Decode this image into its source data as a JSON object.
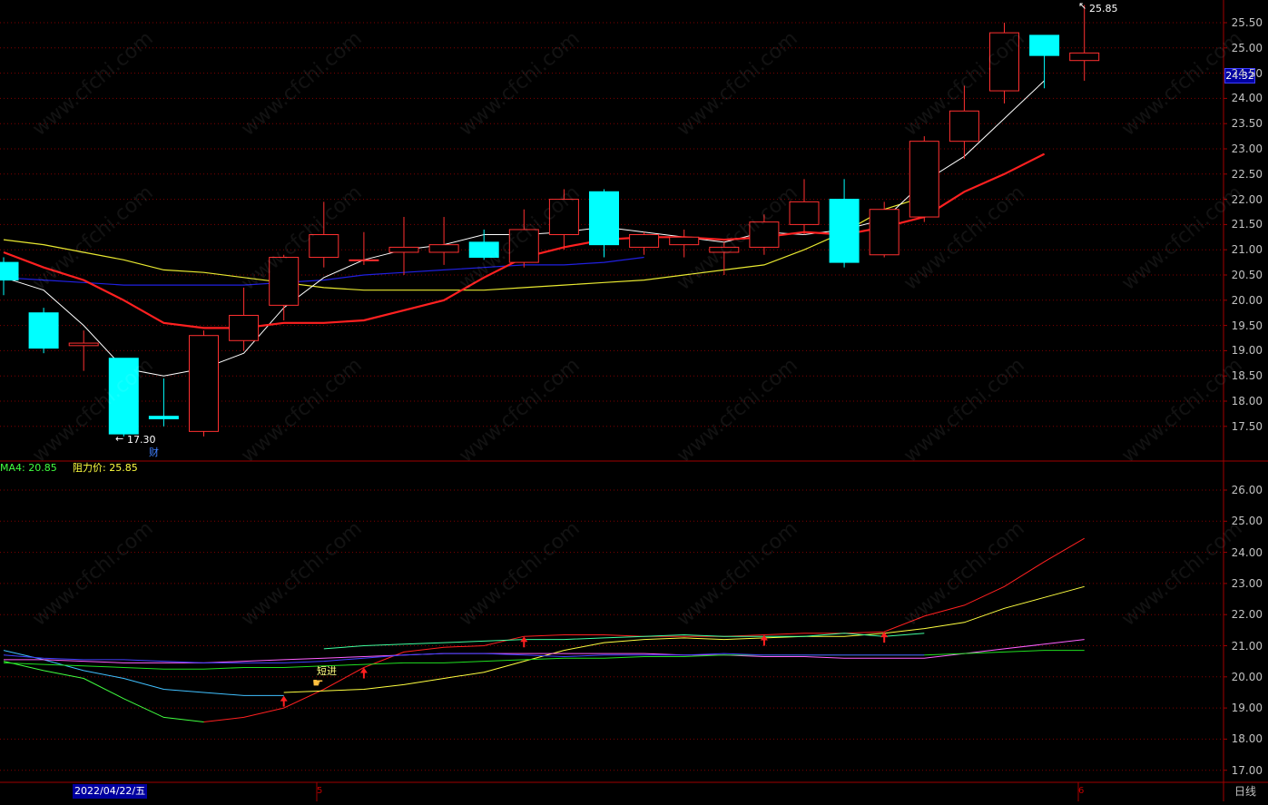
{
  "chart_data": [
    {
      "type": "candlestick",
      "panel": "main",
      "ylim": [
        17.2,
        25.85
      ],
      "yticks": [
        "25.50",
        "25.00",
        "24.50",
        "24.00",
        "23.50",
        "23.00",
        "22.50",
        "22.00",
        "21.50",
        "21.00",
        "20.50",
        "20.00",
        "19.50",
        "19.00",
        "18.50",
        "18.00",
        "17.50"
      ],
      "candles": [
        {
          "o": 20.75,
          "h": 20.85,
          "l": 20.1,
          "c": 20.4
        },
        {
          "o": 19.75,
          "h": 19.85,
          "l": 18.95,
          "c": 19.05
        },
        {
          "o": 19.1,
          "h": 19.4,
          "l": 18.6,
          "c": 19.15
        },
        {
          "o": 18.85,
          "h": 18.85,
          "l": 17.3,
          "c": 17.35
        },
        {
          "o": 17.7,
          "h": 18.45,
          "l": 17.5,
          "c": 17.65
        },
        {
          "o": 17.4,
          "h": 19.4,
          "l": 17.3,
          "c": 19.3
        },
        {
          "o": 19.2,
          "h": 20.25,
          "l": 19.0,
          "c": 19.7
        },
        {
          "o": 19.9,
          "h": 20.9,
          "l": 19.6,
          "c": 20.85
        },
        {
          "o": 20.85,
          "h": 21.95,
          "l": 20.65,
          "c": 21.3
        },
        {
          "o": 20.8,
          "h": 21.35,
          "l": 20.7,
          "c": 20.8
        },
        {
          "o": 20.95,
          "h": 21.65,
          "l": 20.5,
          "c": 21.05
        },
        {
          "o": 20.95,
          "h": 21.65,
          "l": 20.7,
          "c": 21.1
        },
        {
          "o": 21.15,
          "h": 21.4,
          "l": 20.8,
          "c": 20.85
        },
        {
          "o": 20.75,
          "h": 21.8,
          "l": 20.65,
          "c": 21.4
        },
        {
          "o": 21.3,
          "h": 22.2,
          "l": 21.0,
          "c": 22.0
        },
        {
          "o": 22.15,
          "h": 22.2,
          "l": 20.85,
          "c": 21.1
        },
        {
          "o": 21.05,
          "h": 21.35,
          "l": 20.9,
          "c": 21.3
        },
        {
          "o": 21.1,
          "h": 21.4,
          "l": 20.85,
          "c": 21.25
        },
        {
          "o": 20.95,
          "h": 21.15,
          "l": 20.5,
          "c": 21.05
        },
        {
          "o": 21.05,
          "h": 21.7,
          "l": 20.9,
          "c": 21.55
        },
        {
          "o": 21.5,
          "h": 22.4,
          "l": 21.3,
          "c": 21.95
        },
        {
          "o": 22.0,
          "h": 22.4,
          "l": 20.65,
          "c": 20.75
        },
        {
          "o": 20.9,
          "h": 21.95,
          "l": 20.85,
          "c": 21.8
        },
        {
          "o": 21.65,
          "h": 23.25,
          "l": 21.55,
          "c": 23.15
        },
        {
          "o": 23.15,
          "h": 24.25,
          "l": 22.8,
          "c": 23.75
        },
        {
          "o": 24.15,
          "h": 25.5,
          "l": 23.9,
          "c": 25.3
        },
        {
          "o": 25.25,
          "h": 25.25,
          "l": 24.2,
          "c": 24.85
        },
        {
          "o": 24.75,
          "h": 25.85,
          "l": 24.35,
          "c": 24.9
        }
      ],
      "ma_white": [
        20.45,
        20.2,
        19.5,
        18.65,
        18.5,
        18.65,
        18.95,
        19.85,
        20.45,
        20.8,
        21.0,
        21.1,
        21.3,
        21.3,
        21.35,
        21.45,
        21.35,
        21.25,
        21.15,
        21.35,
        21.3,
        21.4,
        21.6,
        22.35,
        22.85,
        23.6,
        24.35
      ],
      "ma_red": [
        20.95,
        20.65,
        20.4,
        20.0,
        19.55,
        19.45,
        19.45,
        19.55,
        19.55,
        19.6,
        19.8,
        20.0,
        20.45,
        20.85,
        21.05,
        21.2,
        21.25,
        21.25,
        21.2,
        21.25,
        21.35,
        21.3,
        21.45,
        21.65,
        22.15,
        22.5,
        22.9
      ],
      "ma_yellow": [
        21.2,
        21.1,
        20.95,
        20.8,
        20.6,
        20.55,
        20.45,
        20.35,
        20.25,
        20.2,
        20.2,
        20.2,
        20.2,
        20.25,
        20.3,
        20.35,
        20.4,
        20.5,
        20.6,
        20.7,
        21.0,
        21.35,
        21.8,
        22.05
      ],
      "ma_blue": [
        20.45,
        20.4,
        20.35,
        20.3,
        20.3,
        20.3,
        20.3,
        20.35,
        20.4,
        20.5,
        20.55,
        20.6,
        20.65,
        20.7,
        20.7,
        20.75,
        20.85
      ],
      "annotations": {
        "high": "25.85",
        "low": "17.30",
        "last": "24.32",
        "cai": "财"
      }
    },
    {
      "type": "line",
      "panel": "indicator",
      "ylim": [
        16.5,
        26.5
      ],
      "yticks": [
        "26.00",
        "25.00",
        "24.00",
        "23.00",
        "22.00",
        "21.00",
        "20.00",
        "19.00",
        "18.00",
        "17.00"
      ],
      "series": [
        {
          "color": "#ff2020",
          "values": [
            null,
            null,
            null,
            null,
            null,
            18.55,
            18.7,
            19.0,
            19.6,
            20.3,
            20.8,
            20.95,
            21.0,
            21.3,
            21.35,
            21.35,
            21.3,
            21.3,
            21.3,
            21.35,
            21.4,
            21.4,
            21.45,
            21.95,
            22.3,
            22.9,
            23.7,
            24.45
          ]
        },
        {
          "color": "#ffff40",
          "values": [
            null,
            null,
            null,
            null,
            null,
            null,
            null,
            19.5,
            19.55,
            19.6,
            19.75,
            19.95,
            20.15,
            20.5,
            20.85,
            21.1,
            21.2,
            21.25,
            21.2,
            21.25,
            21.3,
            21.3,
            21.4,
            21.55,
            21.75,
            22.2,
            22.55,
            22.9
          ]
        },
        {
          "color": "#40c0ff",
          "values": [
            20.85,
            20.55,
            20.2,
            19.95,
            19.6,
            19.5,
            19.4,
            19.4,
            null,
            null,
            null,
            null,
            null,
            null,
            null,
            null,
            null,
            null,
            null,
            null,
            null,
            null,
            null,
            null,
            null,
            null,
            null,
            null
          ]
        },
        {
          "color": "#40ff40",
          "values": [
            20.5,
            20.2,
            19.95,
            19.3,
            18.7,
            18.55,
            null,
            null,
            null,
            null,
            null,
            null,
            null,
            null,
            null,
            null,
            null,
            null,
            null,
            null,
            null,
            null,
            null,
            null,
            null,
            null,
            null,
            null
          ]
        },
        {
          "color": "#ff60ff",
          "values": [
            20.55,
            20.55,
            20.5,
            20.45,
            20.45,
            20.45,
            20.5,
            20.55,
            20.6,
            20.65,
            20.7,
            20.75,
            20.75,
            20.75,
            20.75,
            20.75,
            20.75,
            20.7,
            20.7,
            20.65,
            20.65,
            20.6,
            20.6,
            20.6,
            20.75,
            20.9,
            21.05,
            21.2
          ]
        },
        {
          "color": "#20e020",
          "values": [
            20.45,
            20.4,
            20.35,
            20.3,
            20.25,
            20.25,
            20.3,
            20.3,
            20.35,
            20.4,
            20.45,
            20.45,
            20.5,
            20.55,
            20.6,
            20.6,
            20.65,
            20.65,
            20.7,
            20.7,
            20.7,
            20.7,
            20.7,
            20.7,
            20.75,
            20.8,
            20.85,
            20.85
          ]
        },
        {
          "color": "#40ffa0",
          "values": [
            null,
            null,
            null,
            null,
            null,
            null,
            null,
            null,
            20.9,
            21.0,
            21.05,
            21.1,
            21.15,
            21.2,
            21.2,
            21.25,
            21.3,
            21.35,
            21.3,
            21.3,
            21.3,
            21.4,
            21.3,
            21.4,
            null,
            null,
            null,
            null
          ]
        },
        {
          "color": "#4040ff",
          "values": [
            20.7,
            20.6,
            20.55,
            20.55,
            20.5,
            20.45,
            20.45,
            20.45,
            20.5,
            20.6,
            20.7,
            20.75,
            20.75,
            20.7,
            20.65,
            20.7,
            20.7,
            20.7,
            20.75,
            20.7,
            20.7,
            20.7,
            20.7,
            20.7,
            null,
            null,
            null,
            null
          ]
        }
      ],
      "arrows_at": [
        7,
        9,
        13,
        19,
        22
      ],
      "signal_label": "短进"
    }
  ],
  "legend": {
    "ma4": "MA4: 20.85",
    "resist": "阻力价: 25.85"
  },
  "bottom": {
    "date": "2022/04/22/五",
    "tick5": "5",
    "tick6": "6",
    "period": "日线"
  },
  "watermark": "www.cfchi.com",
  "colors": {
    "up": "#ff3030",
    "down": "#00ffff",
    "grid": "#800000",
    "border": "#a00000"
  }
}
